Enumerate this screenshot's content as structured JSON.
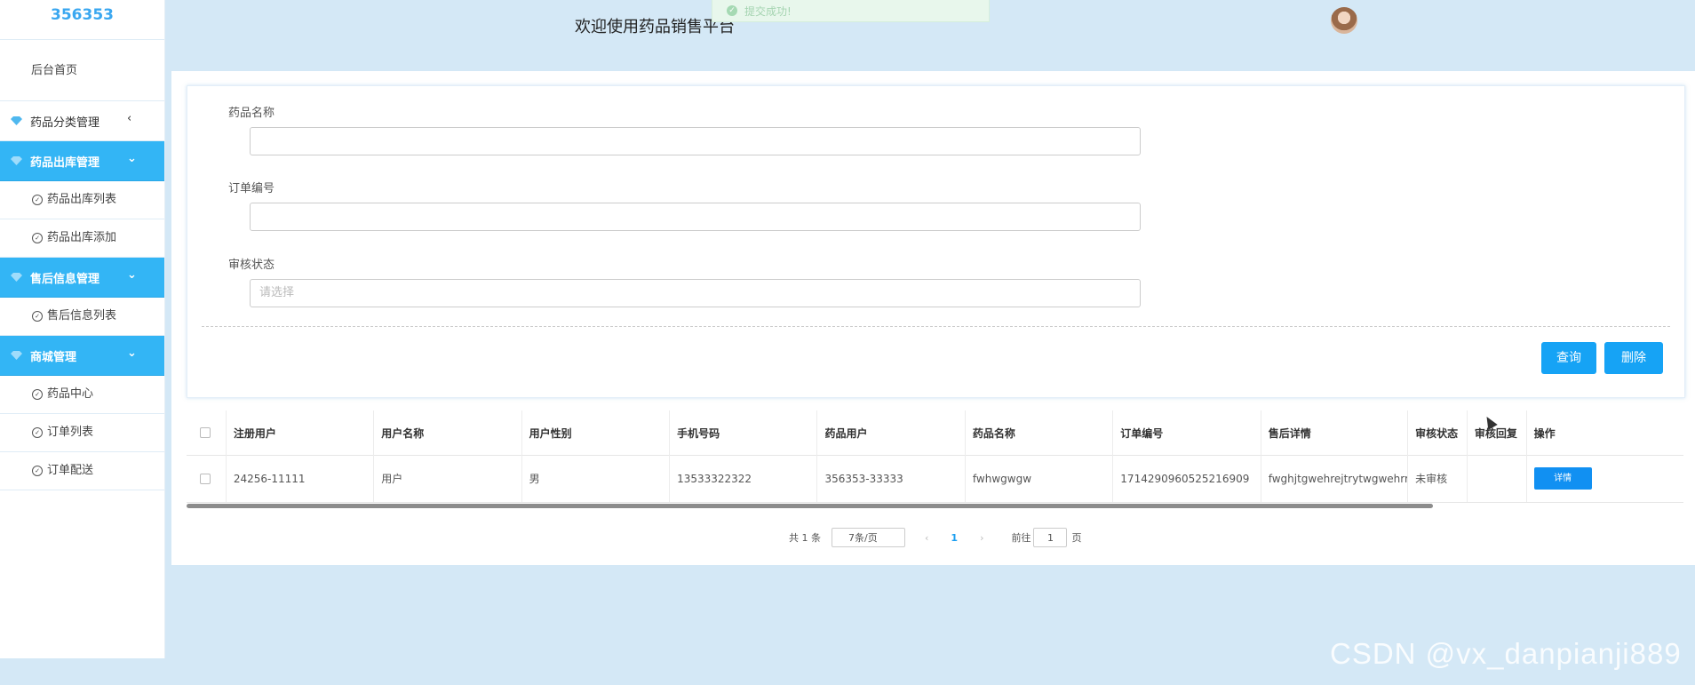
{
  "sidebar": {
    "logo": "356353",
    "home": "后台首页",
    "groups": [
      {
        "label": "药品分类管理",
        "chevron": "‹",
        "items": []
      },
      {
        "label": "药品出库管理",
        "chevron": "⌄",
        "items": [
          "药品出库列表",
          "药品出库添加"
        ]
      },
      {
        "label": "售后信息管理",
        "chevron": "⌄",
        "items": [
          "售后信息列表"
        ]
      },
      {
        "label": "商城管理",
        "chevron": "⌄",
        "items": [
          "药品中心",
          "订单列表",
          "订单配送"
        ]
      }
    ]
  },
  "header": {
    "title": "欢迎使用药品销售平台",
    "toast": "提交成功!"
  },
  "search": {
    "fields": [
      {
        "label": "药品名称",
        "value": "",
        "placeholder": ""
      },
      {
        "label": "订单编号",
        "value": "",
        "placeholder": ""
      },
      {
        "label": "审核状态",
        "value": "",
        "placeholder": "请选择"
      }
    ],
    "query_label": "查询",
    "delete_label": "删除"
  },
  "table": {
    "columns": [
      "注册用户",
      "用户名称",
      "用户性别",
      "手机号码",
      "药品用户",
      "药品名称",
      "订单编号",
      "售后详情",
      "审核状态",
      "审核回复",
      "操作"
    ],
    "rows": [
      {
        "cells": [
          "24256-11111",
          "用户",
          "男",
          "13533322322",
          "356353-33333",
          "fwhwgwgw",
          "1714290960525216909",
          "fwghjtgwehrejtrytwgwehrrt",
          "未审核",
          ""
        ],
        "action": "详情"
      }
    ]
  },
  "pagination": {
    "total": "共 1 条",
    "page_size": "7条/页",
    "prev": "‹",
    "current": "1",
    "next": "›",
    "goto_prefix": "前往",
    "goto_value": "1",
    "goto_suffix": "页"
  },
  "watermark": "CSDN @vx_danpianji889",
  "colors": {
    "accent": "#33b5f5",
    "button": "#16a3f5",
    "background": "#d4e8f6"
  }
}
